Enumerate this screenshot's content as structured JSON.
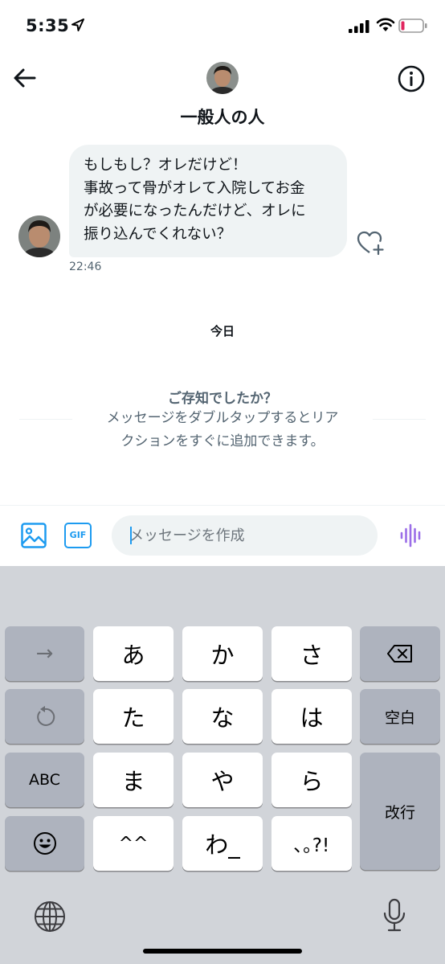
{
  "status_bar": {
    "time": "5:35"
  },
  "header": {
    "title": "一般人の人"
  },
  "conversation": {
    "message": {
      "text": "もしもし？オレだけど！\n事故って骨がオレて入院してお金\nが必要になったんだけど、オレに\n振り込んでくれない？",
      "time": "22:46"
    },
    "day_divider": "今日",
    "tip": {
      "title": "ご存知でしたか？",
      "body": "メッセージをダブルタップするとリア\nクションをすぐに追加できます。"
    }
  },
  "composer": {
    "gif_label": "GIF",
    "placeholder": "メッセージを作成",
    "value": ""
  },
  "keyboard": {
    "rows": [
      [
        "→",
        "あ",
        "か",
        "さ",
        "⌫"
      ],
      [
        "↺",
        "た",
        "な",
        "は",
        "空白"
      ],
      [
        "ABC",
        "ま",
        "や",
        "ら",
        "改行"
      ],
      [
        "☺",
        "^^",
        "わ_",
        "､｡?!"
      ]
    ],
    "labels": {
      "arrow": "→",
      "a": "あ",
      "ka": "か",
      "sa": "さ",
      "ta": "た",
      "na": "な",
      "ha": "は",
      "space": "空白",
      "abc": "ABC",
      "ma": "ま",
      "ya": "や",
      "ra": "ら",
      "return": "改行",
      "emoticon": "^^",
      "wa": "わ_",
      "punct": "､｡?!"
    }
  },
  "colors": {
    "accent": "#1d9bf0",
    "bubble_bg": "#eff3f4",
    "secondary_text": "#536471",
    "voice_purple": "#9b6ee8",
    "keyboard_bg": "#d1d4d9",
    "func_key_bg": "#aeb3be",
    "battery_low": "#e0245e"
  },
  "icons": {
    "status_arrow": "location-arrow-icon",
    "signal": "cellular-signal-icon",
    "wifi": "wifi-icon",
    "battery": "battery-low-icon",
    "back": "back-arrow-icon",
    "info": "info-icon",
    "react": "heart-plus-icon",
    "media": "image-icon",
    "voice": "voice-waveform-icon",
    "undo": "undo-icon",
    "emoji": "emoji-icon",
    "delete": "delete-key-icon",
    "globe": "globe-icon",
    "mic": "microphone-icon"
  }
}
